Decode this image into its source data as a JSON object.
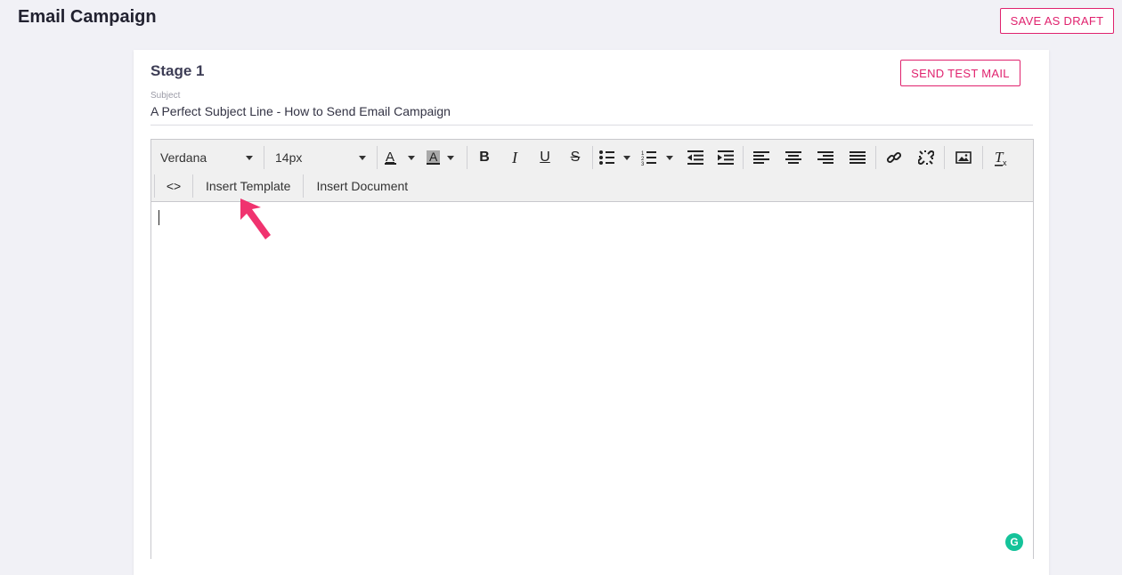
{
  "header": {
    "title": "Email Campaign",
    "save_draft_label": "SAVE AS DRAFT"
  },
  "stage": {
    "title": "Stage 1",
    "send_test_label": "SEND TEST MAIL",
    "subject_label": "Subject",
    "subject_value": "A Perfect Subject Line - How to Send Email Campaign"
  },
  "toolbar": {
    "font_family": "Verdana",
    "font_size": "14px",
    "bold_glyph": "B",
    "italic_glyph": "I",
    "underline_glyph": "U",
    "strike_glyph": "S",
    "source_glyph": "<>",
    "insert_template_label": "Insert Template",
    "insert_document_label": "Insert Document"
  },
  "colors": {
    "accent": "#e0226e",
    "grammarly": "#15c39a"
  }
}
